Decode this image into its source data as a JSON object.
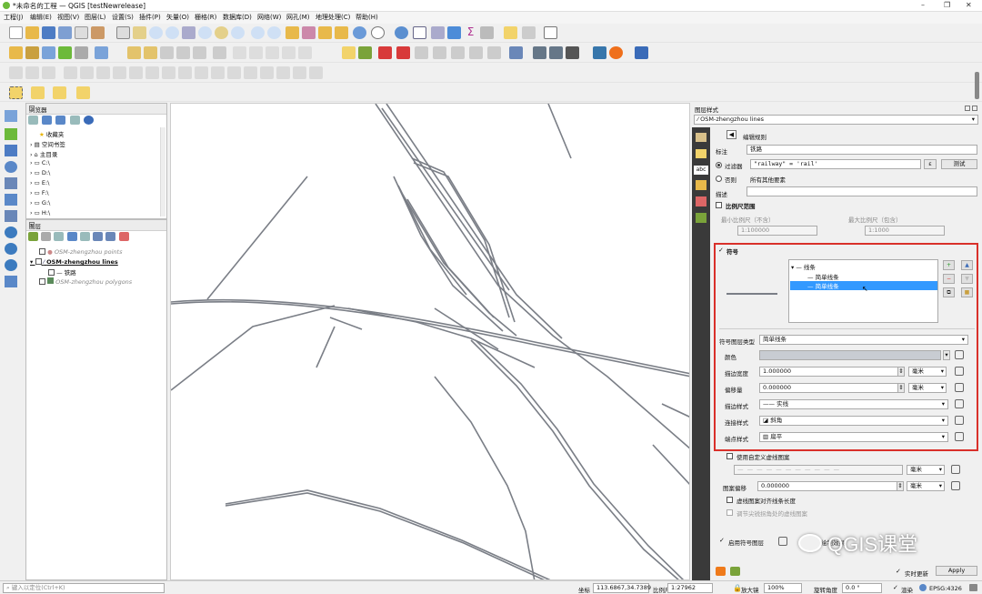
{
  "window": {
    "title": "*未命名的工程 — QGIS [testNewrelease]"
  },
  "menu": [
    "工程(J)",
    "编辑(E)",
    "视图(V)",
    "图层(L)",
    "设置(S)",
    "插件(P)",
    "矢量(O)",
    "栅格(R)",
    "数据库(D)",
    "网络(W)",
    "网孔(M)",
    "地理处理(C)",
    "帮助(H)"
  ],
  "browser": {
    "title": "浏览器",
    "items": [
      "收藏夹",
      "空间书签",
      "主目录",
      "C:\\",
      "D:\\",
      "E:\\",
      "F:\\",
      "G:\\",
      "H:\\"
    ]
  },
  "layers": {
    "title": "图层",
    "items": [
      "OSM-zhengzhou points",
      "OSM-zhengzhou lines",
      "铁路",
      "OSM-zhengzhou polygons"
    ]
  },
  "style_panel": {
    "title": "图层样式",
    "layer_select": "OSM-zhengzhou lines",
    "edit_rule": "编辑规则",
    "label_lbl": "标注",
    "label_val": "铁路",
    "filter_lbl": "过滤器",
    "filter_val": "\"railway\" = 'rail'",
    "epsilon": "ε",
    "test_btn": "测试",
    "else_lbl": "否则",
    "else_desc": "所有其他要素",
    "desc_lbl": "描述",
    "scale_lbl": "比例尺范围",
    "min_scale_lbl": "最小比例尺（不含）",
    "max_scale_lbl": "最大比例尺（包含）",
    "min_scale": "1:100000",
    "max_scale": "1:1000",
    "symbol_lbl": "符号",
    "sym_tree": [
      "线条",
      "简单线条",
      "简单线条"
    ],
    "layer_type_lbl": "符号图层类型",
    "layer_type_val": "简单线条",
    "color_lbl": "颜色",
    "width_lbl": "描边宽度",
    "width_val": "1.000000",
    "offset_lbl": "偏移量",
    "offset_val": "0.000000",
    "unit_mm": "毫米",
    "stroke_style_lbl": "描边样式",
    "stroke_style_val": "实线",
    "join_lbl": "连接样式",
    "join_val": "斜角",
    "cap_lbl": "端点样式",
    "cap_val": "扁平",
    "custom_dash_lbl": "使用自定义虚线图案",
    "pattern_offset_lbl": "图案偏移",
    "pattern_offset_val": "0.000000",
    "align_dash_lbl": "虚线图案对齐线条长度",
    "tweak_dash_lbl": "调节尖锐拐角处的虚线图案",
    "enable_layer_lbl": "启用符号图层",
    "effects_lbl": "绘制效果",
    "live_update_lbl": "实时更新",
    "apply_btn": "Apply"
  },
  "watermark": "QGIS课堂",
  "status": {
    "locate_placeholder": "键入以定位(Ctrl+K)",
    "coord_lbl": "坐标",
    "coord_val": "113.6867,34.7389",
    "scale_lbl": "比例尺",
    "scale_val": "1:27962",
    "magnifier_lbl": "放大镜",
    "magnifier_val": "100%",
    "rotation_lbl": "旋转角度",
    "rotation_val": "0.0 °",
    "render_lbl": "渲染",
    "crs": "EPSG:4326"
  },
  "colors": {
    "highlight": "#3399ff",
    "red_frame": "#d9302a",
    "rail": "#7a7e86"
  }
}
